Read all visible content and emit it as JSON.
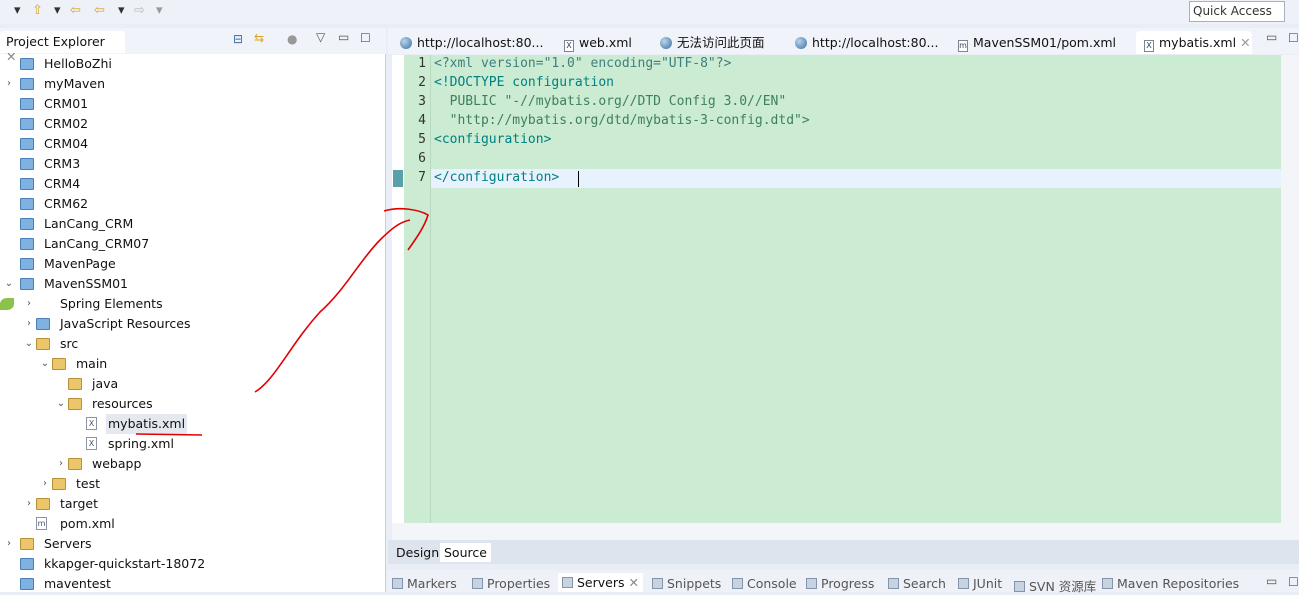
{
  "toolbar": {
    "quick_access": "Quick Access"
  },
  "project_explorer": {
    "title": "Project Explorer",
    "items": [
      {
        "label": "HelloBoZhi",
        "level": 0,
        "icon": "project-icon",
        "twisty": ""
      },
      {
        "label": "myMaven",
        "level": 0,
        "icon": "project-icon",
        "twisty": "collapsed"
      },
      {
        "label": "CRM01",
        "level": 0,
        "icon": "project-icon",
        "twisty": ""
      },
      {
        "label": "CRM02",
        "level": 0,
        "icon": "project-icon",
        "twisty": ""
      },
      {
        "label": "CRM04",
        "level": 0,
        "icon": "project-icon",
        "twisty": ""
      },
      {
        "label": "CRM3",
        "level": 0,
        "icon": "project-icon",
        "twisty": ""
      },
      {
        "label": "CRM4",
        "level": 0,
        "icon": "project-icon",
        "twisty": ""
      },
      {
        "label": "CRM62",
        "level": 0,
        "icon": "project-icon",
        "twisty": ""
      },
      {
        "label": "LanCang_CRM",
        "level": 0,
        "icon": "project-icon",
        "twisty": ""
      },
      {
        "label": "LanCang_CRM07",
        "level": 0,
        "icon": "project-icon",
        "twisty": ""
      },
      {
        "label": "MavenPage",
        "level": 0,
        "icon": "project-icon",
        "twisty": ""
      },
      {
        "label": "MavenSSM01",
        "level": 0,
        "icon": "maven-project-icon",
        "twisty": "expanded"
      },
      {
        "label": "Spring Elements",
        "level": 1,
        "icon": "spring-icon",
        "twisty": "collapsed"
      },
      {
        "label": "JavaScript Resources",
        "level": 1,
        "icon": "js-resources-icon",
        "twisty": "collapsed"
      },
      {
        "label": "src",
        "level": 1,
        "icon": "folder-icon",
        "twisty": "expanded"
      },
      {
        "label": "main",
        "level": 2,
        "icon": "folder-icon",
        "twisty": "expanded"
      },
      {
        "label": "java",
        "level": 3,
        "icon": "folder-icon",
        "twisty": ""
      },
      {
        "label": "resources",
        "level": 2.5,
        "icon": "folder-icon",
        "twisty": "expanded"
      },
      {
        "label": "mybatis.xml",
        "level": 4,
        "icon": "xml-file-icon",
        "twisty": "",
        "selected": true
      },
      {
        "label": "spring.xml",
        "level": 4,
        "icon": "xml-file-icon",
        "twisty": ""
      },
      {
        "label": "webapp",
        "level": 3,
        "icon": "folder-icon",
        "twisty": "collapsed"
      },
      {
        "label": "test",
        "level": 2,
        "icon": "folder-icon",
        "twisty": "collapsed"
      },
      {
        "label": "target",
        "level": 1,
        "icon": "folder-icon",
        "twisty": "collapsed"
      },
      {
        "label": "pom.xml",
        "level": 1,
        "icon": "maven-file-icon",
        "twisty": ""
      },
      {
        "label": "Servers",
        "level": 0,
        "icon": "folder-icon",
        "twisty": "collapsed"
      },
      {
        "label": "kkapger-quickstart-18072",
        "level": 0,
        "icon": "project-icon",
        "twisty": ""
      },
      {
        "label": "maventest",
        "level": 0,
        "icon": "project-icon",
        "twisty": ""
      }
    ]
  },
  "editor": {
    "tabs": [
      {
        "label": "http://localhost:80...",
        "icon": "globe-icon"
      },
      {
        "label": "web.xml",
        "icon": "xml-file-icon"
      },
      {
        "label": "无法访问此页面",
        "icon": "globe-icon"
      },
      {
        "label": "http://localhost:80...",
        "icon": "globe-icon"
      },
      {
        "label": "MavenSSM01/pom.xml",
        "icon": "maven-file-icon"
      },
      {
        "label": "mybatis.xml",
        "icon": "xml-file-icon",
        "active": true
      }
    ],
    "lines": [
      {
        "n": "1",
        "text": "<?xml version=\"1.0\" encoding=\"UTF-8\"?>"
      },
      {
        "n": "2",
        "text": "<!DOCTYPE configuration"
      },
      {
        "n": "3",
        "text": "  PUBLIC \"-//mybatis.org//DTD Config 3.0//EN\""
      },
      {
        "n": "4",
        "text": "  \"http://mybatis.org/dtd/mybatis-3-config.dtd\">"
      },
      {
        "n": "5",
        "text": "<configuration>"
      },
      {
        "n": "6",
        "text": ""
      },
      {
        "n": "7",
        "text": "</configuration>"
      }
    ],
    "bottom_tabs": [
      "Design",
      "Source"
    ],
    "active_bottom_tab": "Source"
  },
  "bottom_panel": {
    "tabs": [
      "Markers",
      "Properties",
      "Servers",
      "Snippets",
      "Console",
      "Progress",
      "Search",
      "JUnit",
      "SVN 资源库",
      "Maven Repositories"
    ],
    "active": "Servers"
  },
  "colors": {
    "editor_bg": "#cbebd2",
    "annotation": "#e00000"
  }
}
